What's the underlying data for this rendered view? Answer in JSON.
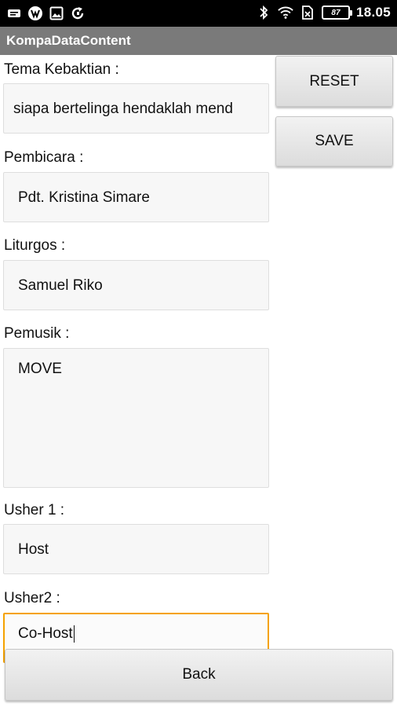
{
  "status_bar": {
    "battery_percent": "87",
    "time": "18.05"
  },
  "app": {
    "title": "KompaDataContent"
  },
  "form": {
    "tema_label": "Tema Kebaktian :",
    "tema_value": "siapa bertelinga hendaklah mend",
    "pembicara_label": "Pembicara :",
    "pembicara_value": "Pdt. Kristina Simare",
    "liturgos_label": "Liturgos :",
    "liturgos_value": "Samuel Riko",
    "pemusik_label": "Pemusik :",
    "pemusik_value": "MOVE",
    "usher1_label": "Usher 1 :",
    "usher1_value": "Host",
    "usher2_label": "Usher2 :",
    "usher2_value": "Co-Host"
  },
  "buttons": {
    "reset": "RESET",
    "save": "SAVE",
    "back": "Back"
  },
  "colors": {
    "status_bar": "#000000",
    "title_bar": "#7a7a7a",
    "focus_border": "#f5a200"
  }
}
